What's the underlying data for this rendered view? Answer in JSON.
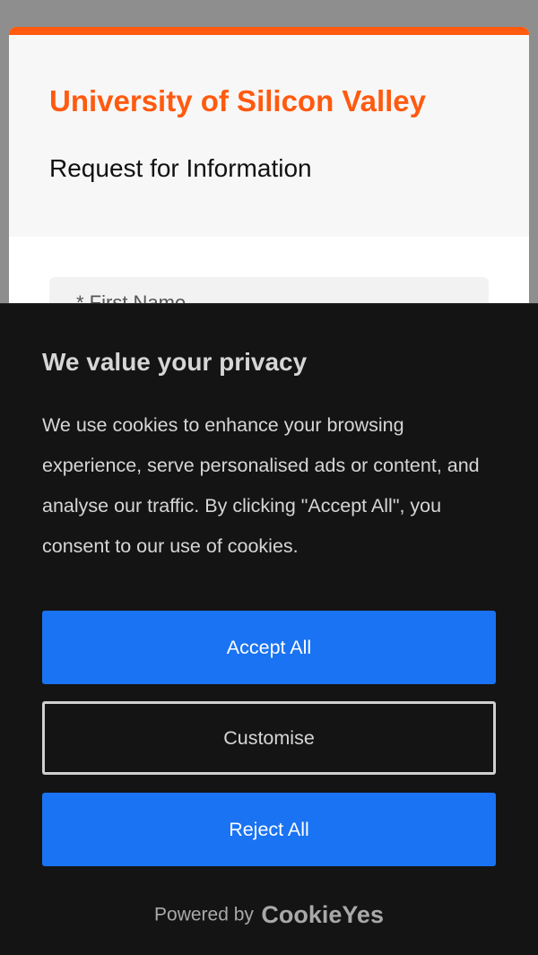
{
  "form": {
    "university_name": "University of Silicon Valley",
    "subtitle": "Request for Information",
    "first_name_label": "* First Name"
  },
  "cookie_banner": {
    "title": "We value your privacy",
    "body": "We use cookies to enhance your browsing experience, serve personalised ads or content, and analyse our traffic. By clicking \"Accept All\", you consent to our use of cookies.",
    "accept_label": "Accept All",
    "customise_label": "Customise",
    "reject_label": "Reject All",
    "powered_by": "Powered by",
    "brand": "CookieYes"
  },
  "colors": {
    "accent": "#ff5a0f",
    "button_blue": "#1a73f2",
    "banner_bg": "#141414"
  }
}
